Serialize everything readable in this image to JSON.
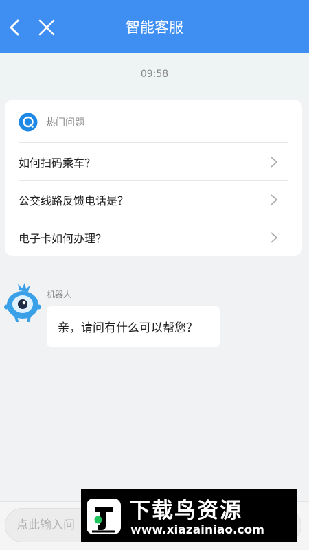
{
  "header": {
    "title": "智能客服"
  },
  "chat": {
    "time": "09:58"
  },
  "hot_questions": {
    "title": "热门问题",
    "items": [
      {
        "label": "如何扫码乘车？"
      },
      {
        "label": "公交线路反馈电话是？"
      },
      {
        "label": "电子卡如何办理？"
      }
    ]
  },
  "bot": {
    "name": "机器人",
    "message": "亲，请问有什么可以帮您？"
  },
  "input": {
    "placeholder": "点此输入问"
  },
  "watermark": {
    "title": "下载鸟资源",
    "url": "www.xiazainiao.com"
  },
  "colors": {
    "header": "#3f8ef2",
    "accent_green": "#20c25c"
  },
  "icons": [
    "back-arrow-icon",
    "close-icon",
    "q-bubble-icon",
    "chevron-right-icon",
    "robot-avatar"
  ]
}
